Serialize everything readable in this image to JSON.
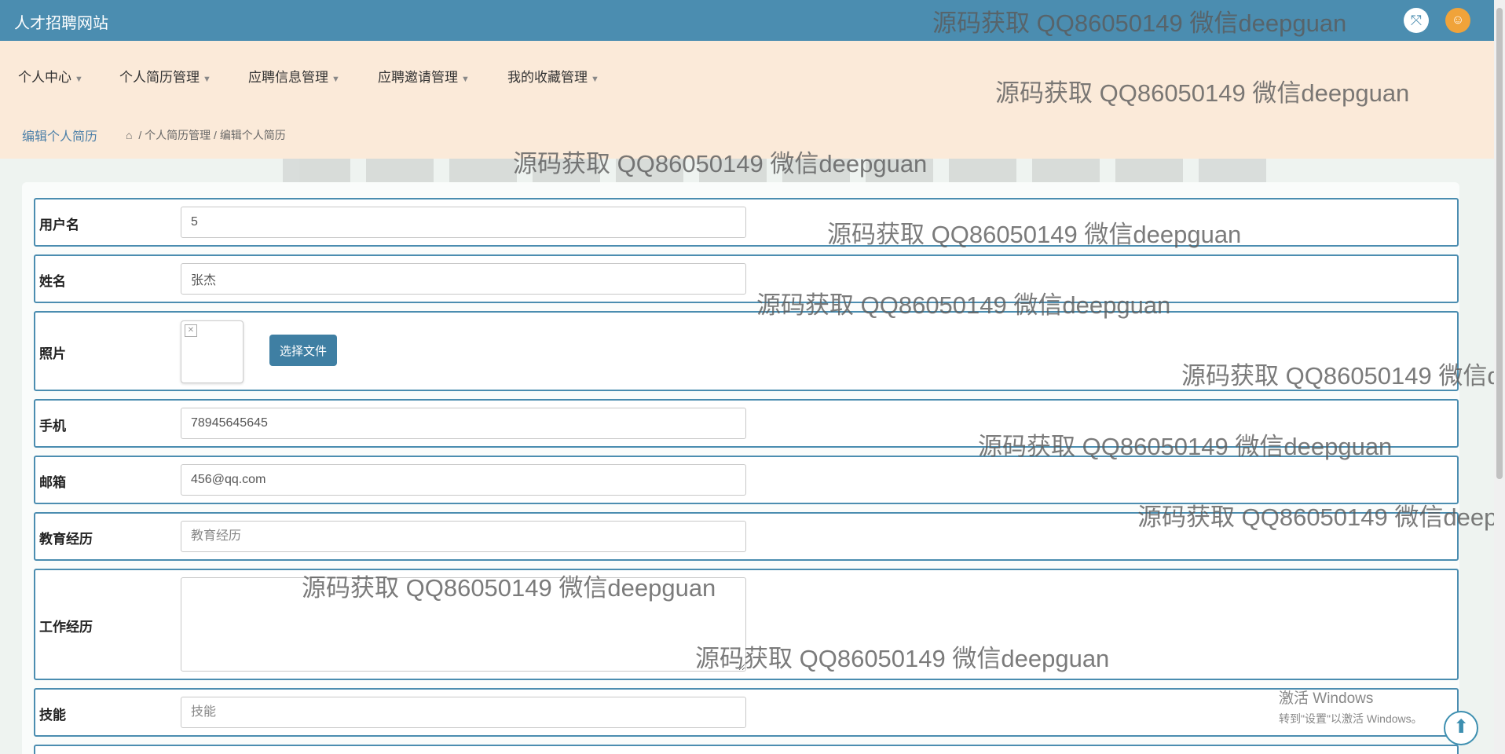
{
  "header": {
    "site_title": "人才招聘网站",
    "expand_icon": "expand-icon",
    "avatar_icon": "user-avatar-icon",
    "colors": {
      "topbar": "#4b8db0",
      "nav_bg": "#fbead9",
      "accent": "#3f7fa3"
    }
  },
  "nav": {
    "items": [
      {
        "label": "个人中心"
      },
      {
        "label": "个人简历管理"
      },
      {
        "label": "应聘信息管理"
      },
      {
        "label": "应聘邀请管理"
      },
      {
        "label": "我的收藏管理"
      }
    ]
  },
  "breadcrumb": {
    "page_title": "编辑个人简历",
    "items": [
      "个人简历管理",
      "编辑个人简历"
    ],
    "separator": "/"
  },
  "form": {
    "username": {
      "label": "用户名",
      "value": "5"
    },
    "name": {
      "label": "姓名",
      "value": "张杰"
    },
    "photo": {
      "label": "照片",
      "button": "选择文件"
    },
    "phone": {
      "label": "手机",
      "value": "78945645645"
    },
    "email": {
      "label": "邮箱",
      "value": "456@qq.com"
    },
    "education": {
      "label": "教育经历",
      "value": "",
      "placeholder": "教育经历"
    },
    "work": {
      "label": "工作经历",
      "value": ""
    },
    "skills": {
      "label": "技能",
      "value": "",
      "placeholder": "技能"
    }
  },
  "watermark_text": "源码获取 QQ86050149 微信deepguan",
  "watermark_cut_1": "源码获取 QQ86050149 微信d",
  "watermark_cut_2": "源码获取 QQ86050149 微信deepg",
  "os_notice": {
    "line1": "激活 Windows",
    "line2": "转到\"设置\"以激活 Windows。"
  }
}
